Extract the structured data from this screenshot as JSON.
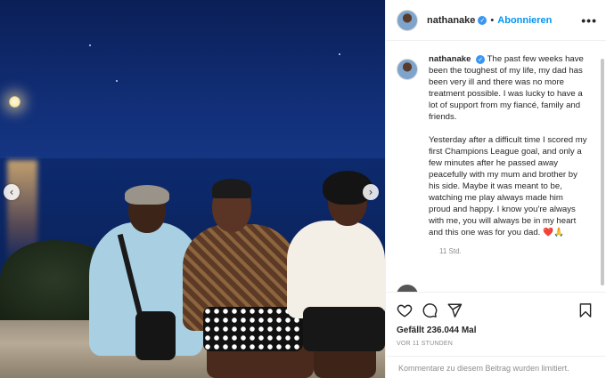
{
  "header": {
    "username": "nathanake",
    "separator": "•",
    "follow_label": "Abonnieren",
    "more_label": "•••"
  },
  "caption": {
    "username": "nathanake",
    "paragraph_1": "The past few weeks have been the toughest of my life, my dad has been very ill and there was no more treatment possible. I was lucky to have a lot of support from my fiancé, family and friends.",
    "paragraph_2": "Yesterday after a difficult time I scored my first Champions League goal, and only a few minutes after he passed away peacefully with my mum and brother by his side. Maybe it was meant to be, watching me play always made him proud and happy. I know you're always with me, you will always be in my heart and this one was for you dad.",
    "emoji": "❤️🙏",
    "time": "11 Std."
  },
  "actions": {
    "likes": "Gefällt 236.044 Mal",
    "post_time": "VOR 11 STUNDEN",
    "comments_disabled": "Kommentare zu diesem Beitrag wurden limitiert."
  },
  "icons": {
    "verified": "verified-badge-icon",
    "like": "heart-icon",
    "comment": "comment-icon",
    "share": "share-icon",
    "save": "bookmark-icon",
    "prev": "chevron-left-icon",
    "next": "chevron-right-icon"
  },
  "carousel": {
    "prev_glyph": "‹",
    "next_glyph": "›"
  },
  "colors": {
    "link": "#0095f6",
    "verified": "#3897f0",
    "secondary_text": "#8e8e8e"
  }
}
